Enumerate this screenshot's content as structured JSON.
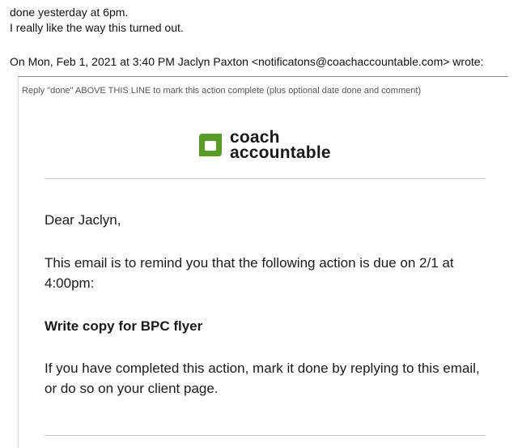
{
  "reply": {
    "line1": "done yesterday at 6pm.",
    "line2": "I really like the way this turned out."
  },
  "quote_header": "On Mon, Feb 1, 2021 at 3:40 PM Jaclyn Paxton <notificatons@coachaccountable.com> wrote:",
  "instruction": "Reply \"done\" ABOVE THIS LINE to mark this action complete (plus optional date done and comment)",
  "logo": {
    "line1": "coach",
    "line2": "accountable",
    "color": "#5a9a2a",
    "icon": "coachaccountable-logo-icon"
  },
  "email": {
    "greeting": "Dear Jaclyn,",
    "reminder": "This email is to remind you that the following action is due on 2/1 at 4:00pm:",
    "action_title": "Write copy for BPC flyer",
    "completed_note": "If you have completed this action, mark it done by replying to this email, or do so on your client page."
  }
}
